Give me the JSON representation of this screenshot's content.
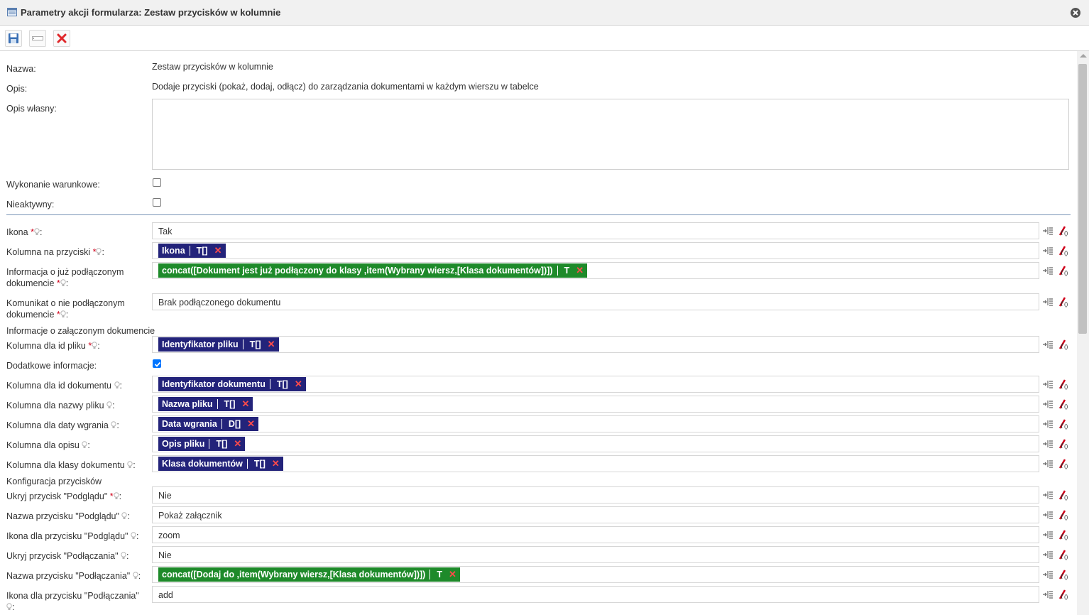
{
  "window": {
    "title": "Parametry akcji formularza: Zestaw przycisków w kolumnie"
  },
  "toolbar": {
    "buttons": [
      "save-icon",
      "field-icon",
      "delete-icon"
    ]
  },
  "form": {
    "name_label": "Nazwa:",
    "name_value": "Zestaw przycisków w kolumnie",
    "desc_label": "Opis:",
    "desc_value": "Dodaje przyciski (pokaż, dodaj, odłącz) do zarządzania dokumentami w każdym wierszu w tabelce",
    "custom_desc_label": "Opis własny:",
    "custom_desc_value": "",
    "conditional_label": "Wykonanie warunkowe:",
    "conditional_checked": false,
    "inactive_label": "Nieaktywny:",
    "inactive_checked": false
  },
  "params": {
    "required_mark": "*",
    "colon": ":",
    "ikona": {
      "label": "Ikona",
      "value": "Tak"
    },
    "kolumna_przyciski": {
      "label": "Kolumna na przyciski",
      "tag": "Ikona",
      "type": "T[]"
    },
    "info_podlaczony": {
      "label_line1": "Informacja o już podłączonym",
      "label_line2": "dokumencie",
      "tag": "concat([Dokument jest już podłączony do klasy ,item(Wybrany wiersz,[Klasa dokumentów])])",
      "type": "T"
    },
    "komunikat_nie": {
      "label_line1": "Komunikat o nie podłączonym",
      "label_line2": "dokumencie",
      "value": "Brak podłączonego dokumentu"
    },
    "section_zalaczony": "Informacje o załączonym dokumencie",
    "kolumna_id_pliku": {
      "label": "Kolumna dla id pliku",
      "tag": "Identyfikator pliku",
      "type": "T[]"
    },
    "dodatkowe": {
      "label": "Dodatkowe informacje:",
      "checked": true
    },
    "kolumna_id_dok": {
      "label": "Kolumna dla id dokumentu",
      "tag": "Identyfikator dokumentu",
      "type": "T[]"
    },
    "kolumna_nazwy": {
      "label": "Kolumna dla nazwy pliku",
      "tag": "Nazwa pliku",
      "type": "T[]"
    },
    "kolumna_daty": {
      "label": "Kolumna dla daty wgrania",
      "tag": "Data wgrania",
      "type": "D[]"
    },
    "kolumna_opisu": {
      "label": "Kolumna dla opisu",
      "tag": "Opis pliku",
      "type": "T[]"
    },
    "kolumna_klasy": {
      "label": "Kolumna dla klasy dokumentu",
      "tag": "Klasa dokumentów",
      "type": "T[]"
    },
    "section_konfig": "Konfiguracja przycisków",
    "ukryj_podgladu": {
      "label": "Ukryj przycisk \"Podglądu\"",
      "value": "Nie"
    },
    "nazwa_podgladu": {
      "label": "Nazwa przycisku \"Podglądu\"",
      "value": "Pokaż załącznik"
    },
    "ikona_podgladu": {
      "label": "Ikona dla przycisku \"Podglądu\"",
      "value": "zoom"
    },
    "ukryj_podlaczania": {
      "label": "Ukryj przycisk \"Podłączania\"",
      "value": "Nie"
    },
    "nazwa_podlaczania": {
      "label": "Nazwa przycisku \"Podłączania\"",
      "tag": "concat([Dodaj do ,item(Wybrany wiersz,[Klasa dokumentów])])",
      "type": "T"
    },
    "ikona_podlaczania": {
      "label": "Ikona dla przycisku \"Podłączania\"",
      "value": "add"
    }
  },
  "colors": {
    "tag_blue": "#23237a",
    "tag_green": "#1e8a2a",
    "required": "#d0021b",
    "separator": "#7a95b6"
  }
}
